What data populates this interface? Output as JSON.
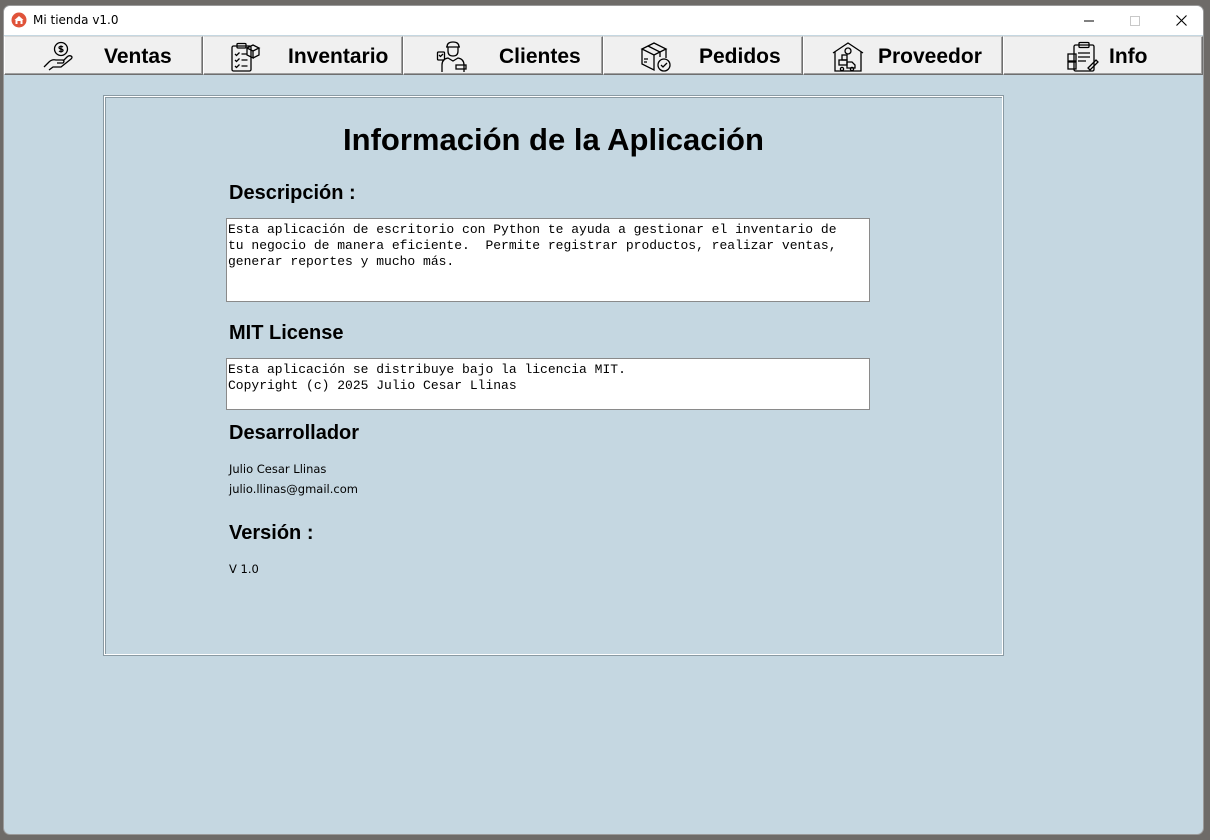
{
  "window": {
    "title": "Mi tienda v1.0",
    "controls": {
      "minimize": "—",
      "maximize": "☐",
      "close": "✕"
    }
  },
  "nav": {
    "items": [
      {
        "label": "Ventas",
        "icon": "money-hand-icon"
      },
      {
        "label": "Inventario",
        "icon": "clipboard-box-icon"
      },
      {
        "label": "Clientes",
        "icon": "customer-icon"
      },
      {
        "label": "Pedidos",
        "icon": "package-check-icon"
      },
      {
        "label": "Proveedor",
        "icon": "warehouse-truck-icon"
      },
      {
        "label": "Info",
        "icon": "clipboard-info-icon"
      }
    ]
  },
  "info": {
    "title": "Información de la Aplicación",
    "description_heading": "Descripción :",
    "description_text": "Esta aplicación de escritorio con Python te ayuda a gestionar el inventario de\ntu negocio de manera eficiente.  Permite registrar productos, realizar ventas,\ngenerar reportes y mucho más.",
    "license_heading": "MIT License",
    "license_text": "Esta aplicación se distribuye bajo la licencia MIT.\nCopyright (c) 2025 Julio Cesar Llinas",
    "developer_heading": "Desarrollador",
    "developer_name": "Julio Cesar Llinas",
    "developer_email": "julio.llinas@gmail.com",
    "version_heading": "Versión :",
    "version_value": "V 1.0"
  },
  "colors": {
    "background": "#c5d7e1",
    "button_face": "#f0f0f0"
  }
}
